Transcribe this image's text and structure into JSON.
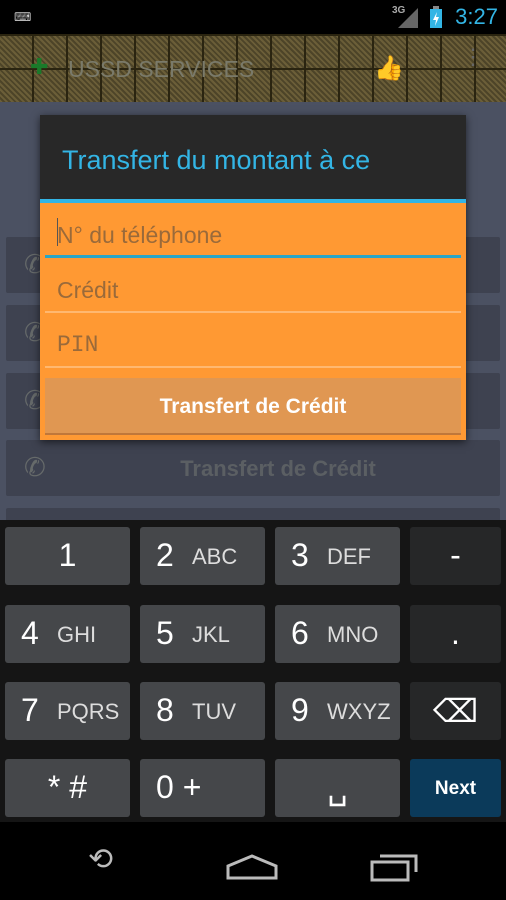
{
  "status_bar": {
    "time": "3:27",
    "network": "3G",
    "icons": [
      "keyboard-icon",
      "signal-icon",
      "battery-charging-icon"
    ]
  },
  "action_bar": {
    "title": "USSD SERVICES",
    "icons": [
      "app-logo-icon",
      "thumbs-up-icon",
      "overflow-menu-icon"
    ]
  },
  "background_list": {
    "items": [
      {
        "label": ""
      },
      {
        "label": ""
      },
      {
        "label": ""
      },
      {
        "label": "Transfert de Crédit"
      },
      {
        "label": ""
      }
    ]
  },
  "dialog": {
    "title": "Transfert du montant à ce",
    "phone_placeholder": "N° du téléphone",
    "credit_placeholder": "Crédit",
    "pin_placeholder": "PIN",
    "submit_label": "Transfert de Crédit"
  },
  "keyboard": {
    "rows": [
      [
        {
          "n": "1",
          "s": ""
        },
        {
          "n": "2",
          "s": "ABC"
        },
        {
          "n": "3",
          "s": "DEF"
        },
        {
          "n": "-",
          "s": ""
        }
      ],
      [
        {
          "n": "4",
          "s": "GHI"
        },
        {
          "n": "5",
          "s": "JKL"
        },
        {
          "n": "6",
          "s": "MNO"
        },
        {
          "n": ".",
          "s": ""
        }
      ],
      [
        {
          "n": "7",
          "s": "PQRS"
        },
        {
          "n": "8",
          "s": "TUV"
        },
        {
          "n": "9",
          "s": "WXYZ"
        },
        {
          "n": "⌫",
          "s": ""
        }
      ],
      [
        {
          "n": "* #",
          "s": ""
        },
        {
          "n": "0 +",
          "s": ""
        },
        {
          "n": "␣",
          "s": ""
        },
        {
          "n": "Next",
          "s": ""
        }
      ]
    ]
  },
  "colors": {
    "accent": "#33b5e5",
    "dialog_bg": "#ff9933",
    "next_key": "#0b3a5a"
  }
}
